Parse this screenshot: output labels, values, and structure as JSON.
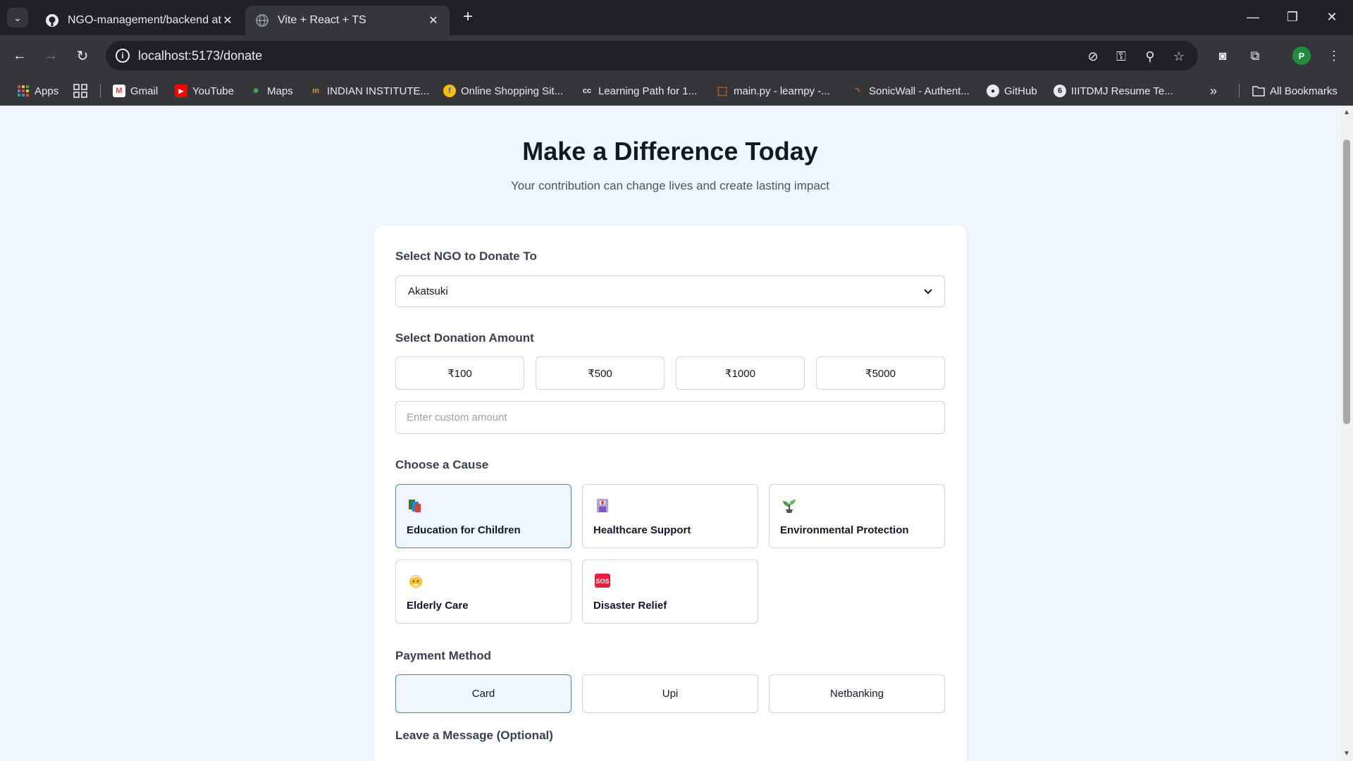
{
  "browser": {
    "tabs": [
      {
        "title": "NGO-management/backend at",
        "icon": "github-icon"
      },
      {
        "title": "Vite + React + TS",
        "icon": "globe-icon"
      }
    ],
    "url": "localhost:5173/donate",
    "profile_initial": "P",
    "bookmarks": [
      {
        "label": "Apps",
        "icon": "apps-grid-icon"
      },
      {
        "label": "Gmail",
        "icon": "gmail-icon"
      },
      {
        "label": "YouTube",
        "icon": "youtube-icon"
      },
      {
        "label": "Maps",
        "icon": "maps-pin-icon"
      },
      {
        "label": "INDIAN INSTITUTE...",
        "icon": "institute-icon"
      },
      {
        "label": "Online Shopping Sit...",
        "icon": "shopping-icon"
      },
      {
        "label": "Learning Path for 1...",
        "icon": "codechef-icon"
      },
      {
        "label": "main.py - learnpy -...",
        "icon": "replit-icon"
      },
      {
        "label": "SonicWall - Authent...",
        "icon": "sonicwall-icon"
      },
      {
        "label": "GitHub",
        "icon": "github-icon"
      },
      {
        "label": "IIITDMJ Resume Te...",
        "icon": "overleaf-icon"
      }
    ],
    "all_bookmarks_label": "All Bookmarks"
  },
  "page": {
    "title": "Make a Difference Today",
    "subtitle": "Your contribution can change lives and create lasting impact"
  },
  "form": {
    "ngo_label": "Select NGO to Donate To",
    "ngo_selected": "Akatsuki",
    "amount_label": "Select Donation Amount",
    "amounts": [
      "₹100",
      "₹500",
      "₹1000",
      "₹5000"
    ],
    "custom_amount_placeholder": "Enter custom amount",
    "cause_label": "Choose a Cause",
    "causes": [
      {
        "label": "Education for Children",
        "emoji": "📚",
        "selected": true
      },
      {
        "label": "Healthcare Support",
        "emoji": "🏥",
        "selected": false
      },
      {
        "label": "Environmental Protection",
        "emoji": "🌱",
        "selected": false
      },
      {
        "label": "Elderly Care",
        "emoji": "👴",
        "selected": false
      },
      {
        "label": "Disaster Relief",
        "emoji": "🆘",
        "selected": false
      }
    ],
    "payment_label": "Payment Method",
    "payment_methods": [
      {
        "label": "Card",
        "selected": true
      },
      {
        "label": "Upi",
        "selected": false
      },
      {
        "label": "Netbanking",
        "selected": false
      }
    ],
    "message_label": "Leave a Message (Optional)"
  },
  "colors": {
    "accent": "#3b82f6",
    "page_background": "#eff6ff",
    "selected_background": "#eff6ff"
  }
}
